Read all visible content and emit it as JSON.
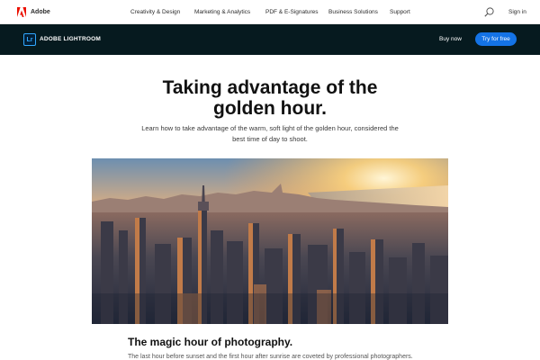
{
  "global_nav": {
    "brand": "Adobe",
    "items": [
      {
        "label": "Creativity & Design"
      },
      {
        "label": "Marketing & Analytics"
      },
      {
        "label": "PDF & E-Signatures"
      },
      {
        "label": "Business Solutions"
      },
      {
        "label": "Support"
      }
    ],
    "search_icon": "search-icon",
    "signin_label": "Sign in"
  },
  "product_bar": {
    "icon_text": "Lr",
    "product_name": "ADOBE LIGHTROOM",
    "buy_now_label": "Buy now",
    "try_label": "Try for free"
  },
  "hero": {
    "title_line1": "Taking advantage of the",
    "title_line2": "golden hour.",
    "lede_line1": "Learn how to take advantage of the warm, soft light of the golden hour, considered the",
    "lede_line2": "best time of day to shoot."
  },
  "photo": {
    "subject": "city-skyline-golden-hour-image"
  },
  "section": {
    "heading": "The magic hour of photography.",
    "body": "The last hour before sunset and the first hour after sunrise are coveted by professional photographers."
  },
  "colors": {
    "product_bar_bg": "#061a1f",
    "accent_blue": "#1473e6",
    "lightroom_blue": "#31a8ff",
    "adobe_red": "#eb1000"
  }
}
